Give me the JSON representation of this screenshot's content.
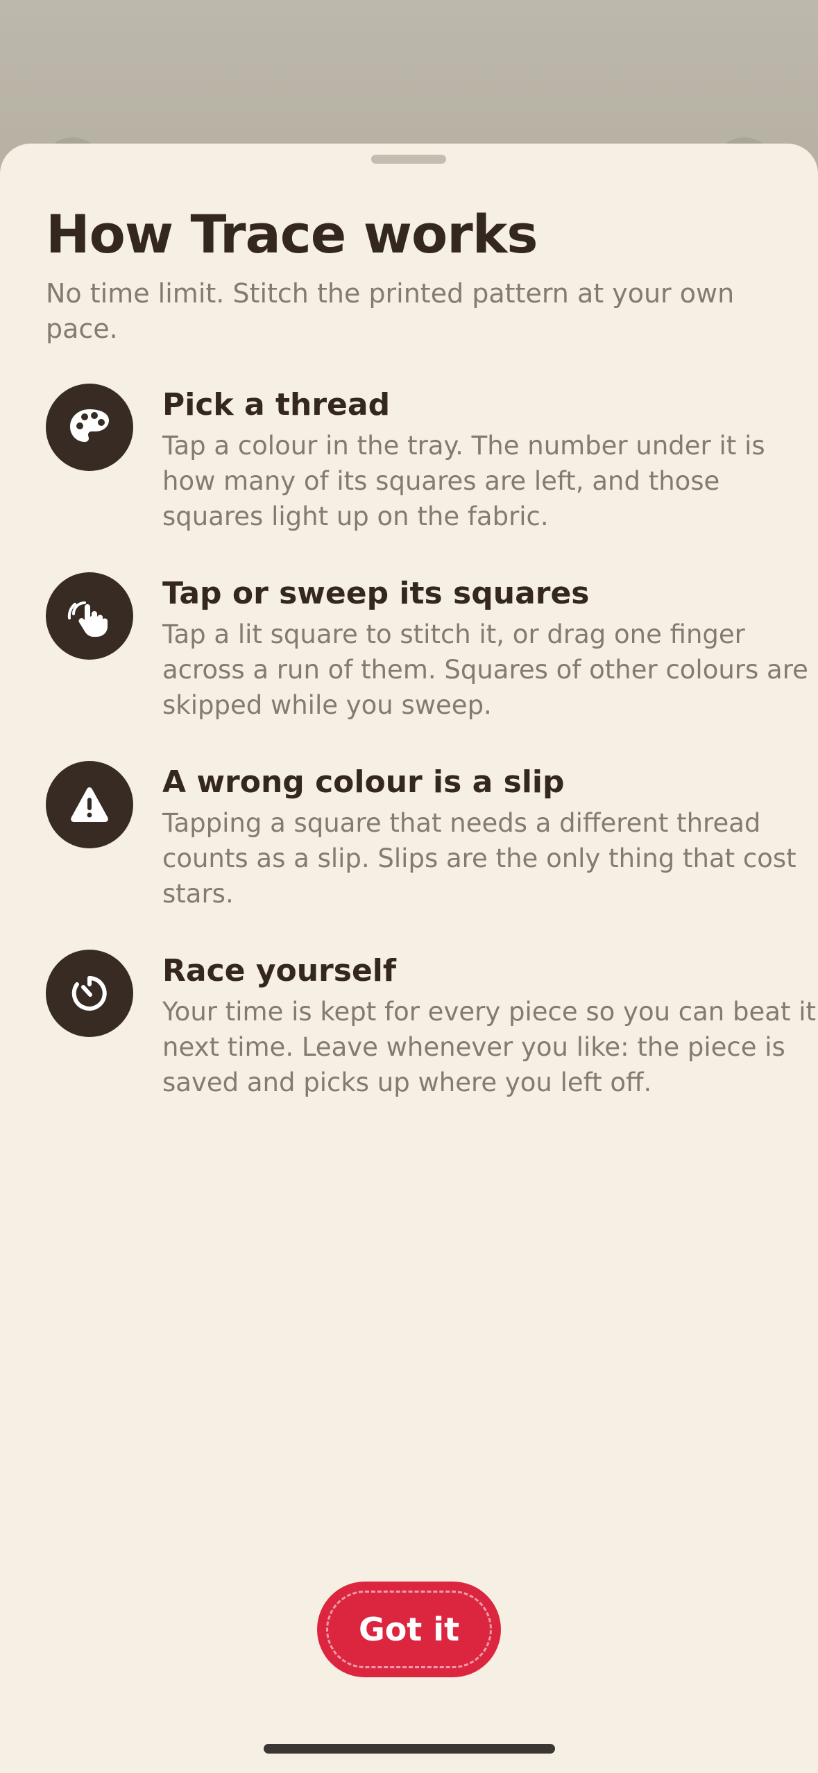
{
  "sheet": {
    "title": "How Trace works",
    "subtitle": "No time limit. Stitch the printed pattern at your own pace.",
    "steps": [
      {
        "icon": "palette-icon",
        "title": "Pick a thread",
        "body": "Tap a colour in the tray. The number under it is how many of its squares are left, and those squares light up on the fabric."
      },
      {
        "icon": "hand-tap-icon",
        "title": "Tap or sweep its squares",
        "body": "Tap a lit square to stitch it, or drag one finger across a run of them. Squares of other colours are skipped while you sweep."
      },
      {
        "icon": "warning-icon",
        "title": "A wrong colour is a slip",
        "body": "Tapping a square that needs a different thread counts as a slip. Slips are the only thing that cost stars."
      },
      {
        "icon": "timer-icon",
        "title": "Race yourself",
        "body": "Your time is kept for every piece so you can beat it next time. Leave whenever you like: the piece is saved and picks up where you left off."
      }
    ],
    "confirm_label": "Got it"
  },
  "colors": {
    "sheet_background": "#f6efe4",
    "text_primary": "#33271f",
    "text_secondary": "#847a70",
    "icon_badge": "#372b23",
    "accent": "#dc2640"
  }
}
